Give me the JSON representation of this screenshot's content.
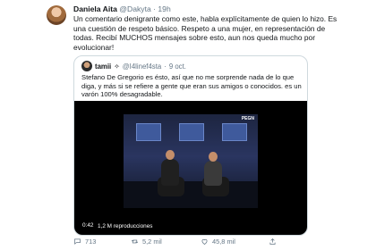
{
  "tweet": {
    "author_name": "Daniela Aita",
    "author_handle": "@Dakyta",
    "separator": "·",
    "time": "19h",
    "text": "Un comentario denigrante como este, habla explícitamente de quien lo hizo. Es una cuestión de respeto básico. Respeto a una mujer, en representación de todas. Recibí MUCHOS mensajes sobre esto, aun nos queda mucho por evolucionar!"
  },
  "quoted": {
    "author_name": "tamii",
    "author_emoji": "✧",
    "author_handle": "@I4linef4sta",
    "separator": "·",
    "date": "9 oct.",
    "text": "Stefano De Gregorio es ésto, así que no me sorprende nada de lo que diga, y más si se refiere a gente que eran sus amigos o conocidos. es un varón 100% desagradable.",
    "video": {
      "duration": "0:42",
      "views": "1,2 M reproducciones",
      "logo": "PEGN"
    }
  },
  "actions": {
    "replies": "713",
    "retweets": "5,2 mil",
    "likes": "45,8 mil"
  }
}
